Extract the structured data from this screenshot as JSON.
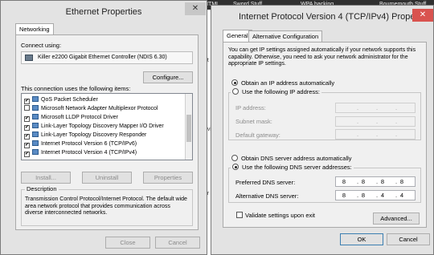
{
  "background": {
    "bookmarks": [
      "HTML",
      "Sword Stuff",
      "WPA hacking",
      "Bournemouth Stuff"
    ],
    "page_words": [
      "nt",
      "evi",
      "ar"
    ]
  },
  "ethernet": {
    "title": "Ethernet Properties",
    "close_glyph": "✕",
    "tab_networking": "Networking",
    "connect_using_label": "Connect using:",
    "adapter_name": "Killer e2200 Gigabit Ethernet Controller (NDIS 6.30)",
    "configure_button": "Configure...",
    "items_label": "This connection uses the following items:",
    "items": [
      {
        "checked": true,
        "label": "QoS Packet Scheduler"
      },
      {
        "checked": false,
        "label": "Microsoft Network Adapter Multiplexor Protocol"
      },
      {
        "checked": true,
        "label": "Microsoft LLDP Protocol Driver"
      },
      {
        "checked": true,
        "label": "Link-Layer Topology Discovery Mapper I/O Driver"
      },
      {
        "checked": true,
        "label": "Link-Layer Topology Discovery Responder"
      },
      {
        "checked": true,
        "label": "Internet Protocol Version 6 (TCP/IPv6)"
      },
      {
        "checked": true,
        "label": "Internet Protocol Version 4 (TCP/IPv4)"
      }
    ],
    "install_button": "Install...",
    "uninstall_button": "Uninstall",
    "properties_button": "Properties",
    "description_label": "Description",
    "description_text": "Transmission Control Protocol/Internet Protocol. The default wide area network protocol that provides communication across diverse interconnected networks.",
    "close_button": "Close",
    "cancel_button": "Cancel"
  },
  "ipv4": {
    "title": "Internet Protocol Version 4 (TCP/IPv4) Properties",
    "close_glyph": "✕",
    "tab_general": "General",
    "tab_alternative": "Alternative Configuration",
    "intro": "You can get IP settings assigned automatically if your network supports this capability. Otherwise, you need to ask your network administrator for the appropriate IP settings.",
    "obtain_ip_auto": "Obtain an IP address automatically",
    "use_following_ip": "Use the following IP address:",
    "ip_address_label": "IP address:",
    "subnet_mask_label": "Subnet mask:",
    "default_gateway_label": "Default gateway:",
    "obtain_dns_auto": "Obtain DNS server address automatically",
    "use_following_dns": "Use the following DNS server addresses:",
    "preferred_dns_label": "Preferred DNS server:",
    "preferred_dns": [
      "8",
      "8",
      "8",
      "8"
    ],
    "alternate_dns_label": "Alternative DNS server:",
    "alternate_dns": [
      "8",
      "8",
      "4",
      "4"
    ],
    "validate_label": "Validate settings upon exit",
    "advanced_button": "Advanced...",
    "ok_button": "OK",
    "cancel_button": "Cancel"
  }
}
